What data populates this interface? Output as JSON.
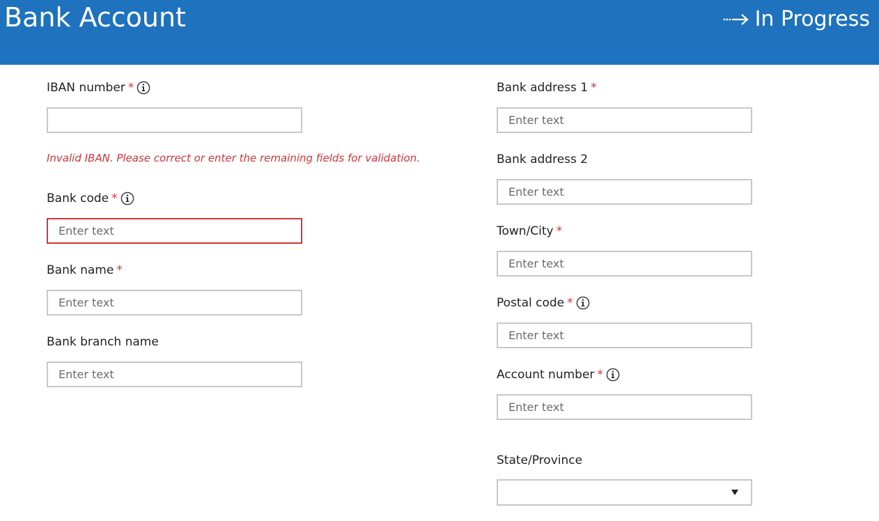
{
  "header": {
    "title": "Bank Account",
    "status": "In Progress",
    "status_icon": "dotted-arrow-right-icon",
    "background_color": "#1f72be"
  },
  "colors": {
    "required": "#d13438",
    "error": "#d13438",
    "border": "#c8c8c8"
  },
  "left_fields": {
    "iban": {
      "label": "IBAN number",
      "required": "*",
      "value": "",
      "placeholder": ""
    },
    "iban_error": "Invalid IBAN.  Please correct or enter the remaining fields for validation.",
    "bank_code": {
      "label": "Bank code",
      "required": "*",
      "placeholder": "Enter text"
    },
    "bank_name": {
      "label": "Bank name",
      "required": "*",
      "placeholder": "Enter text"
    },
    "bank_branch_name": {
      "label": "Bank branch name",
      "placeholder": "Enter text"
    }
  },
  "right_fields": {
    "bank_address_1": {
      "label": "Bank address 1",
      "required": "*",
      "placeholder": "Enter text"
    },
    "bank_address_2": {
      "label": "Bank address 2",
      "placeholder": "Enter text"
    },
    "town_city": {
      "label": "Town/City",
      "required": "*",
      "placeholder": "Enter text"
    },
    "postal_code": {
      "label": "Postal code",
      "required": "*",
      "placeholder": "Enter text"
    },
    "account_number": {
      "label": "Account number",
      "required": "*",
      "placeholder": "Enter text"
    },
    "state_province": {
      "label": "State/Province",
      "selected": ""
    }
  }
}
